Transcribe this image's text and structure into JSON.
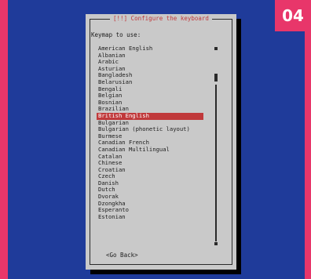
{
  "badge": "04",
  "dialog": {
    "title": "[!!] Configure the keyboard",
    "prompt": "Keymap to use:",
    "items": [
      "American English",
      "Albanian",
      "Arabic",
      "Asturian",
      "Bangladesh",
      "Belarusian",
      "Bengali",
      "Belgian",
      "Bosnian",
      "Brazilian",
      "British English",
      "Bulgarian",
      "Bulgarian (phonetic layout)",
      "Burmese",
      "Canadian French",
      "Canadian Multilingual",
      "Catalan",
      "Chinese",
      "Croatian",
      "Czech",
      "Danish",
      "Dutch",
      "Dvorak",
      "Dzongkha",
      "Esperanto",
      "Estonian"
    ],
    "selected": "British English",
    "go_back": "<Go Back>"
  },
  "colors": {
    "border_accent": "#e8366a",
    "screen_bg": "#1f3b9a",
    "dialog_bg": "#c9c9c9",
    "highlight": "#c0393b"
  }
}
